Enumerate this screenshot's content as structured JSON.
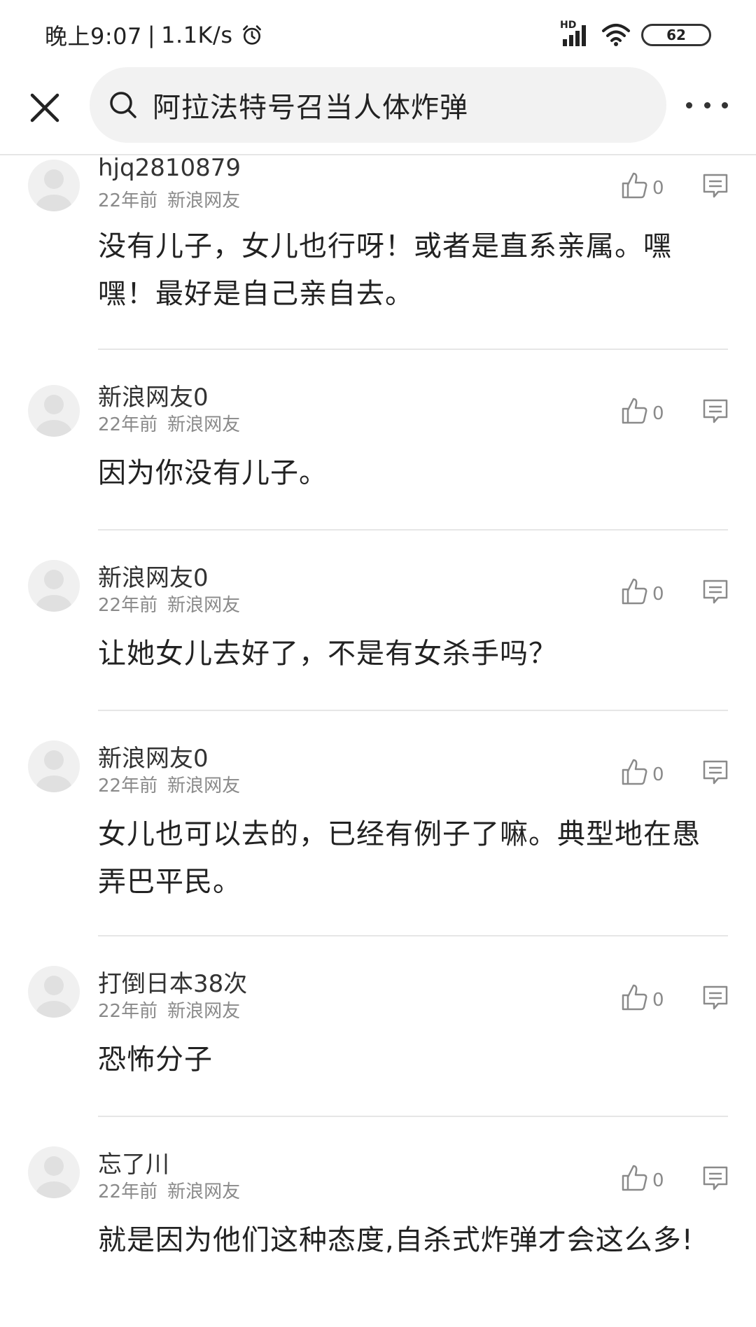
{
  "status_bar": {
    "time": "晚上9:07",
    "speed": "1.1K/s",
    "network": "HD",
    "battery": "62"
  },
  "search": {
    "query": "阿拉法特号召当人体炸弹"
  },
  "comments": [
    {
      "user": "hjq2810879",
      "time": "22年前",
      "source": "新浪网友",
      "likes": "0",
      "text": "没有儿子，女儿也行呀！或者是直系亲属。嘿嘿！最好是自己亲自去。"
    },
    {
      "user": "新浪网友0",
      "time": "22年前",
      "source": "新浪网友",
      "likes": "0",
      "text": "因为你没有儿子。"
    },
    {
      "user": "新浪网友0",
      "time": "22年前",
      "source": "新浪网友",
      "likes": "0",
      "text": "让她女儿去好了，不是有女杀手吗？"
    },
    {
      "user": "新浪网友0",
      "time": "22年前",
      "source": "新浪网友",
      "likes": "0",
      "text": "女儿也可以去的，已经有例子了嘛。典型地在愚弄巴平民。"
    },
    {
      "user": "打倒日本38次",
      "time": "22年前",
      "source": "新浪网友",
      "likes": "0",
      "text": "恐怖分子"
    },
    {
      "user": "忘了川",
      "time": "22年前",
      "source": "新浪网友",
      "likes": "0",
      "text": "就是因为他们这种态度,自杀式炸弹才会这么多!"
    }
  ]
}
